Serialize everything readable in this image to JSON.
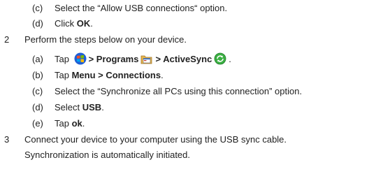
{
  "steps": {
    "s1c": {
      "marker": "(c)",
      "text": "Select the “Allow USB connections“ option."
    },
    "s1d": {
      "marker": "(d)",
      "pre": "Click ",
      "bold": "OK",
      "post": "."
    },
    "s2": {
      "marker": "2",
      "text": "Perform the steps below on your device."
    },
    "s2a": {
      "marker": "(a)",
      "pre": "Tap ",
      "programs": "> Programs",
      "activesync": "> ActiveSync",
      "post": ".",
      "icons": [
        "windows-start-icon",
        "programs-folder-icon",
        "activesync-icon"
      ]
    },
    "s2b": {
      "marker": "(b)",
      "pre": "Tap ",
      "bold": "Menu > Connections",
      "post": "."
    },
    "s2c": {
      "marker": "(c)",
      "text": "Select the “Synchronize all PCs using this connection” option."
    },
    "s2d": {
      "marker": "(d)",
      "pre": "Select ",
      "bold": "USB",
      "post": "."
    },
    "s2e": {
      "marker": "(e)",
      "pre": "Tap ",
      "bold": "ok",
      "post": "."
    },
    "s3": {
      "marker": "3",
      "text": "Connect your device to your computer using the USB sync cable."
    },
    "s3note": {
      "text": "Synchronization is automatically initiated."
    }
  },
  "colors": {
    "text": "#222222",
    "activesync_green": "#3cb043",
    "windows_blue": "#1f5fd6"
  }
}
